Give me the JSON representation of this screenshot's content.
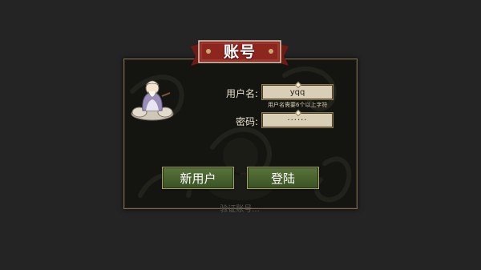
{
  "dialog": {
    "title": "账号"
  },
  "form": {
    "username_label": "用户名:",
    "username_value": "yqq",
    "username_hint": "用户名需要6个以上字符",
    "password_label": "密码:",
    "password_value": "······"
  },
  "buttons": {
    "new_user": "新用户",
    "login": "登陆"
  },
  "status": {
    "text": "验证账号..."
  },
  "colors": {
    "banner_red": "#8e2620",
    "button_green": "#4a6530",
    "field_bg": "#d8cfb6",
    "frame_gold": "#7a6a4a"
  },
  "icons": {
    "avatar": "sage-on-cloud-icon"
  }
}
